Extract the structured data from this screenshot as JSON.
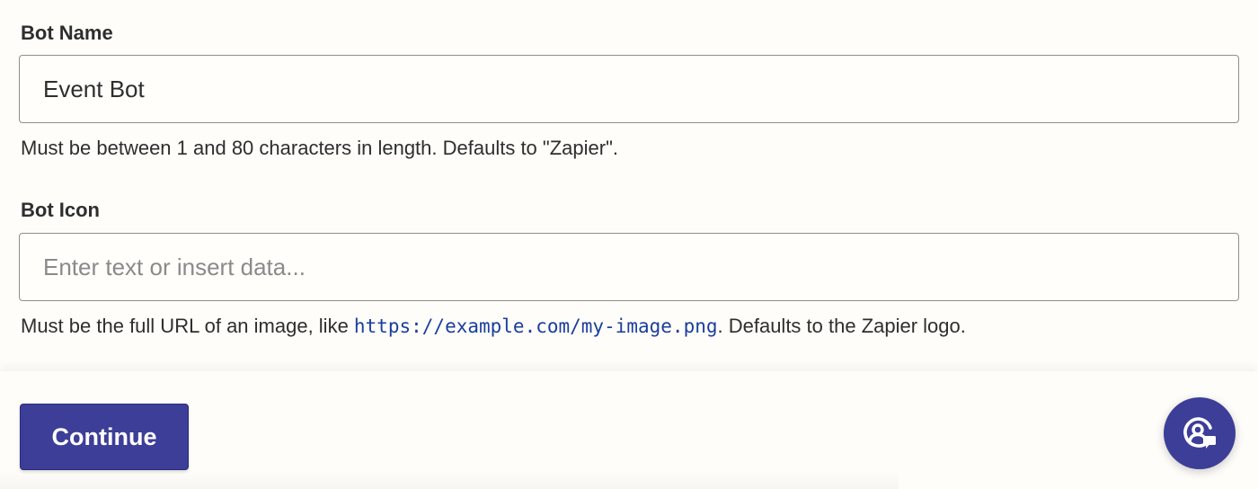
{
  "fields": {
    "bot_name": {
      "label": "Bot Name",
      "value": "Event Bot",
      "help": "Must be between 1 and 80 characters in length. Defaults to \"Zapier\"."
    },
    "bot_icon": {
      "label": "Bot Icon",
      "value": "",
      "placeholder": "Enter text or insert data...",
      "help_before": "Must be the full URL of an image, like ",
      "help_code": "https://example.com/my-image.png",
      "help_after": ". Defaults to the Zapier logo."
    }
  },
  "footer": {
    "continue_label": "Continue",
    "help_icon": "support-chat-icon"
  },
  "colors": {
    "primary": "#3d3e98",
    "background": "#fffdf9",
    "code_link": "#1a3e9e",
    "input_border": "#8f8f8f"
  }
}
